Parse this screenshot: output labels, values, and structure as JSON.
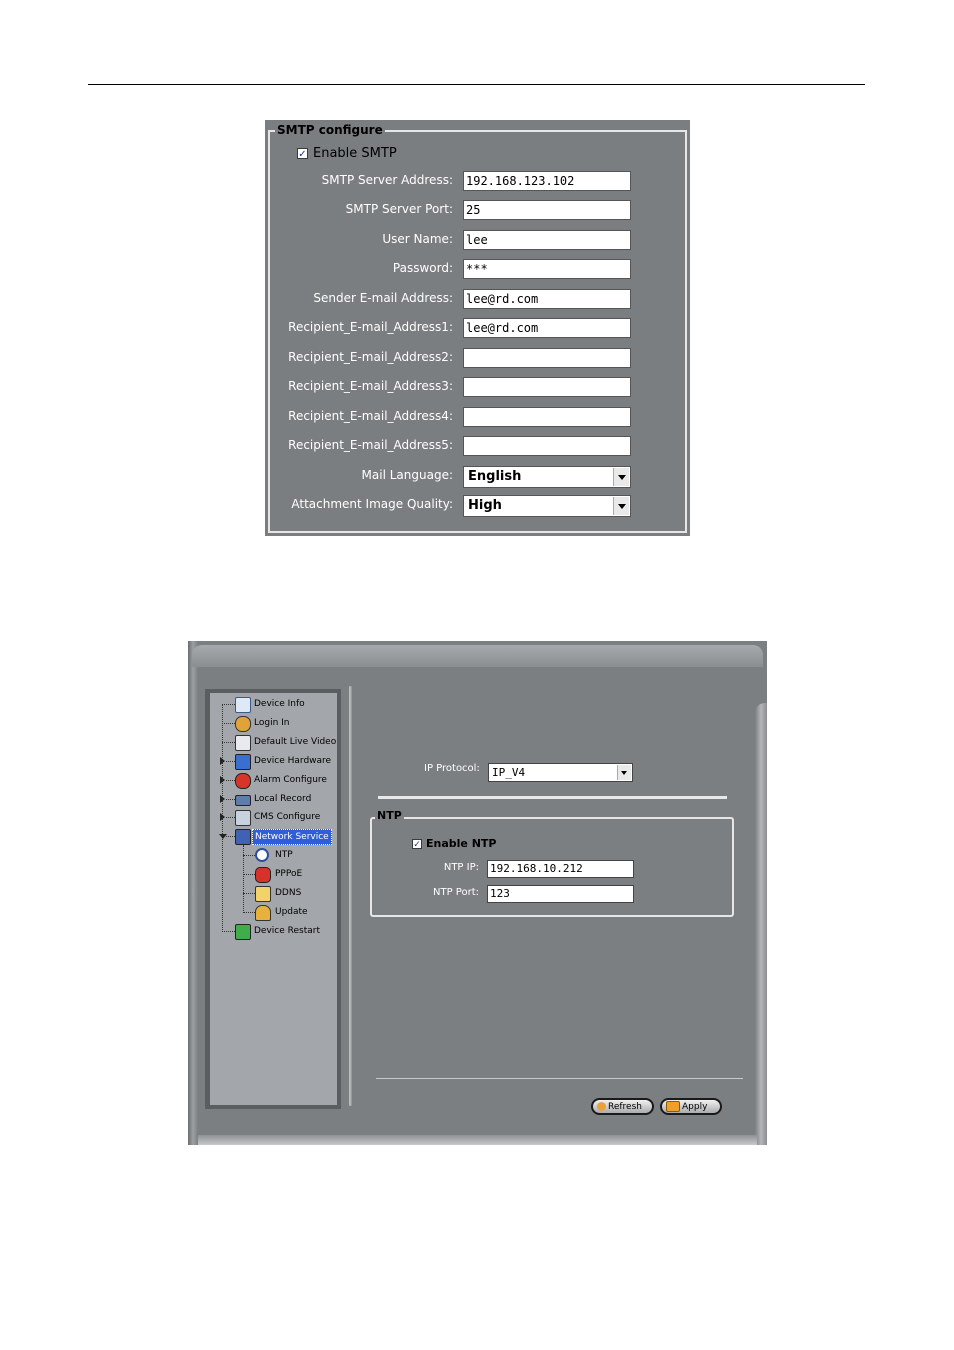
{
  "smtp": {
    "legend": "SMTP configure",
    "enable_checkbox": {
      "label": "Enable SMTP",
      "checked": true
    },
    "fields": [
      {
        "label": "SMTP Server Address:",
        "value": "192.168.123.102"
      },
      {
        "label": "SMTP Server Port:",
        "value": "25"
      },
      {
        "label": "User Name:",
        "value": "lee"
      },
      {
        "label": "Password:",
        "value": "***"
      },
      {
        "label": "Sender E-mail Address:",
        "value": "lee@rd.com"
      },
      {
        "label": "Recipient_E-mail_Address1:",
        "value": "lee@rd.com"
      },
      {
        "label": "Recipient_E-mail_Address2:",
        "value": ""
      },
      {
        "label": "Recipient_E-mail_Address3:",
        "value": ""
      },
      {
        "label": "Recipient_E-mail_Address4:",
        "value": ""
      },
      {
        "label": "Recipient_E-mail_Address5:",
        "value": ""
      }
    ],
    "mail_language": {
      "label": "Mail Language:",
      "value": "English"
    },
    "image_quality": {
      "label": "Attachment Image Quality:",
      "value": "High"
    }
  },
  "network": {
    "tree": [
      {
        "label": "Device Info",
        "icon": "document-icon"
      },
      {
        "label": "Login In",
        "icon": "user-key-icon"
      },
      {
        "label": "Default Live Video",
        "icon": "video-icon"
      },
      {
        "label": "Device Hardware",
        "icon": "tools-icon"
      },
      {
        "label": "Alarm Configure",
        "icon": "alarm-icon"
      },
      {
        "label": "Local Record",
        "icon": "record-icon"
      },
      {
        "label": "CMS Configure",
        "icon": "cms-icon"
      },
      {
        "label": "Network Service",
        "icon": "network-icon",
        "selected": true
      },
      {
        "label": "NTP",
        "icon": "clock-icon"
      },
      {
        "label": "PPPoE",
        "icon": "phone-icon"
      },
      {
        "label": "DDNS",
        "icon": "ddns-icon"
      },
      {
        "label": "Update",
        "icon": "update-icon"
      },
      {
        "label": "Device Restart",
        "icon": "restart-icon"
      }
    ],
    "ip_protocol": {
      "label": "IP Protocol:",
      "value": "IP_V4"
    },
    "ntp": {
      "legend": "NTP",
      "enable": {
        "label": "Enable NTP",
        "checked": true
      },
      "ip": {
        "label": "NTP IP:",
        "value": "192.168.10.212"
      },
      "port": {
        "label": "NTP Port:",
        "value": "123"
      }
    },
    "buttons": {
      "refresh": "Refresh",
      "apply": "Apply"
    }
  }
}
